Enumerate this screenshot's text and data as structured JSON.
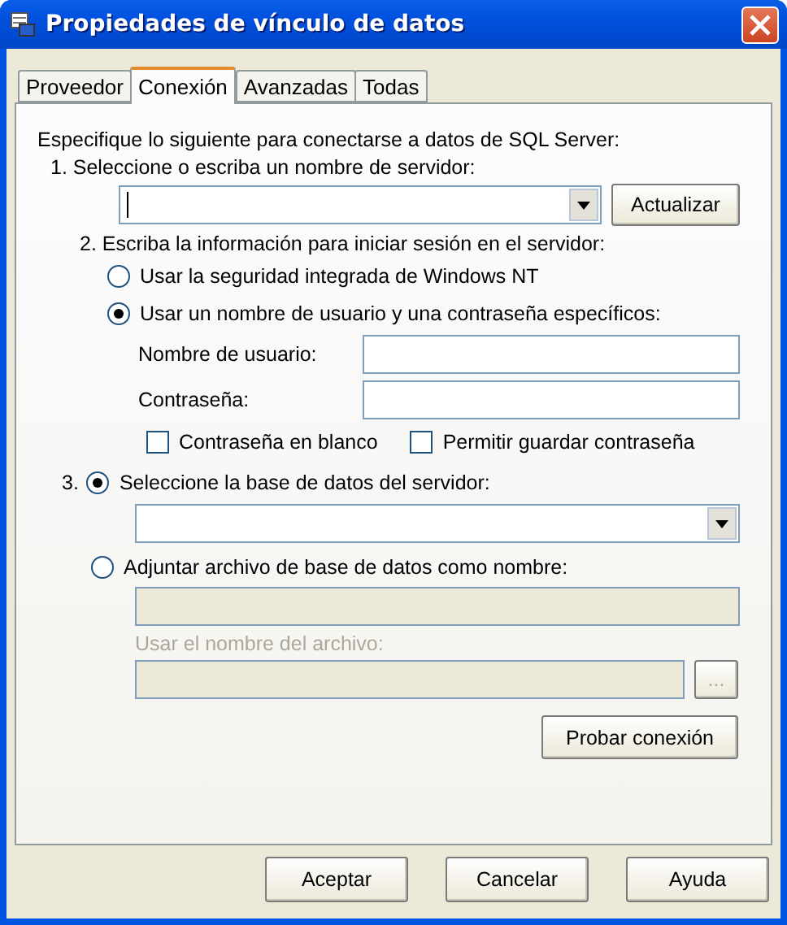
{
  "window": {
    "title": "Propiedades de vínculo de datos"
  },
  "tabs": [
    {
      "label": "Proveedor",
      "selected": false
    },
    {
      "label": "Conexión",
      "selected": true
    },
    {
      "label": "Avanzadas",
      "selected": false
    },
    {
      "label": "Todas",
      "selected": false
    }
  ],
  "intro": "Especifique lo siguiente para conectarse a datos de SQL Server:",
  "server": {
    "step_label": "1. Seleccione o escriba un nombre de servidor:",
    "refresh_button": "Actualizar"
  },
  "login": {
    "step_label": "2. Escriba la información para iniciar sesión en el servidor:",
    "options": [
      {
        "label": "Usar la seguridad integrada de Windows NT",
        "selected": false
      },
      {
        "label": "Usar un nombre de usuario y una contraseña específicos:",
        "selected": true
      }
    ],
    "username_label": "Nombre de usuario:",
    "password_label": "Contraseña:",
    "checkboxes": [
      {
        "label": "Contraseña en blanco",
        "checked": false
      },
      {
        "label": "Permitir guardar contraseña",
        "checked": false
      }
    ]
  },
  "database": {
    "step_number": "3.",
    "options": [
      {
        "label": "Seleccione la base de datos del servidor:",
        "selected": true
      },
      {
        "label": "Adjuntar archivo de base de datos como nombre:",
        "selected": false
      }
    ],
    "file_name_label": "Usar el nombre del archivo:",
    "browse_button": "...",
    "test_button": "Probar conexión"
  },
  "buttons": [
    "Aceptar",
    "Cancelar",
    "Ayuda"
  ]
}
